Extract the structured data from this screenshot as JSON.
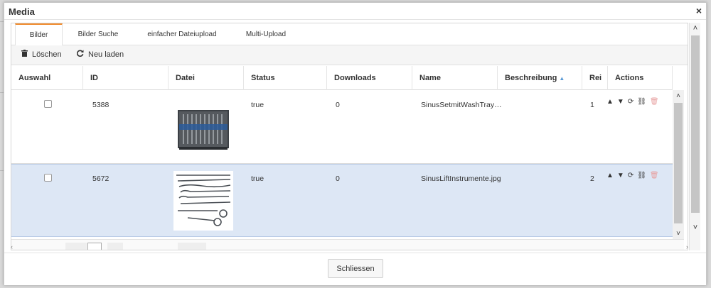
{
  "dialog": {
    "title": "Media",
    "close_symbol": "×"
  },
  "tabs": [
    {
      "label": "Bilder",
      "active": true
    },
    {
      "label": "Bilder Suche",
      "active": false
    },
    {
      "label": "einfacher Dateiupload",
      "active": false
    },
    {
      "label": "Multi-Upload",
      "active": false
    }
  ],
  "toolbar": {
    "delete_label": "Löschen",
    "reload_label": "Neu laden"
  },
  "grid": {
    "columns": [
      "Auswahl",
      "ID",
      "Datei",
      "Status",
      "Downloads",
      "Name",
      "Beschreibung",
      "Rei",
      "Actions"
    ],
    "sorted_column": "Beschreibung",
    "rows": [
      {
        "id": "5388",
        "status": "true",
        "downloads": "0",
        "name": "SinusSetmitWashTray…",
        "beschreibung": "",
        "rei": "1",
        "selected": false,
        "image": "tray-icon"
      },
      {
        "id": "5672",
        "status": "true",
        "downloads": "0",
        "name": "SinusLiftInstrumente.jpg",
        "beschreibung": "",
        "rei": "2",
        "selected": true,
        "image": "instruments-icon"
      }
    ]
  },
  "footer": {
    "close_button_label": "Schliessen"
  },
  "colors": {
    "accent_tab": "#f08c2e",
    "selected_row": "#dde7f5",
    "sort_arrow": "#5a9ad6",
    "delete_icon": "#e7a0a0"
  }
}
